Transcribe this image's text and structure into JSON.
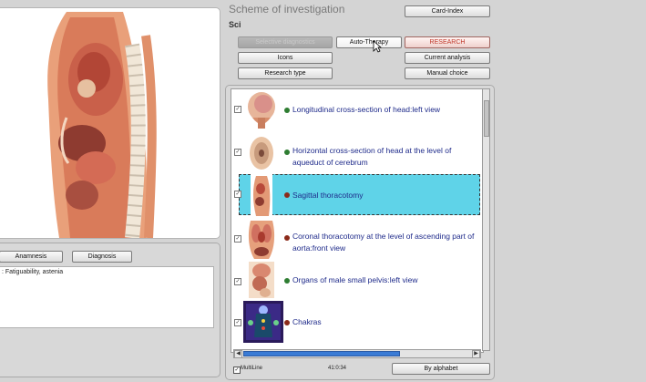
{
  "header": {
    "title": "Scheme of investigation",
    "subtitle": "Sci"
  },
  "buttons": {
    "card_index": "Card-Index",
    "selective_diagnostics": "Selective diagnostics",
    "auto_therapy": "Auto-Therapy",
    "research": "RESEARCH",
    "icons": "Icons",
    "current_analysis": "Current analysis",
    "research_type": "Research type",
    "manual_choice": "Manual choice",
    "anamnesis": "Anamnesis",
    "diagnosis": "Diagnosis",
    "by_alphabet": "By alphabet"
  },
  "left": {
    "notes_text": ": Fatiguability, astenia"
  },
  "list": {
    "items": [
      {
        "label": "Longitudinal cross-section of head:left view",
        "checked": true,
        "bullet": "#2e7d32",
        "selected": false
      },
      {
        "label": "Horizontal cross-section of head at the level of aqueduct of cerebrum",
        "checked": true,
        "bullet": "#2e7d32",
        "selected": false
      },
      {
        "label": "Sagittal thoracotomy",
        "checked": true,
        "bullet": "#8b2a1a",
        "selected": true
      },
      {
        "label": "Coronal thoracotomy at the level of ascending part of aorta:front view",
        "checked": true,
        "bullet": "#8b2a1a",
        "selected": false
      },
      {
        "label": "Organs of male small pelvis:left view",
        "checked": true,
        "bullet": "#2e7d32",
        "selected": false
      },
      {
        "label": "Chakras",
        "checked": true,
        "bullet": "#8b2a1a",
        "selected": false
      }
    ]
  },
  "footer": {
    "multiline_label": "MultiLine",
    "multiline_checked": true,
    "time": "41:0:34"
  },
  "colors": {
    "selection": "#5fd3e8",
    "list_text": "#1e2a8a",
    "research": "#c0392b"
  }
}
